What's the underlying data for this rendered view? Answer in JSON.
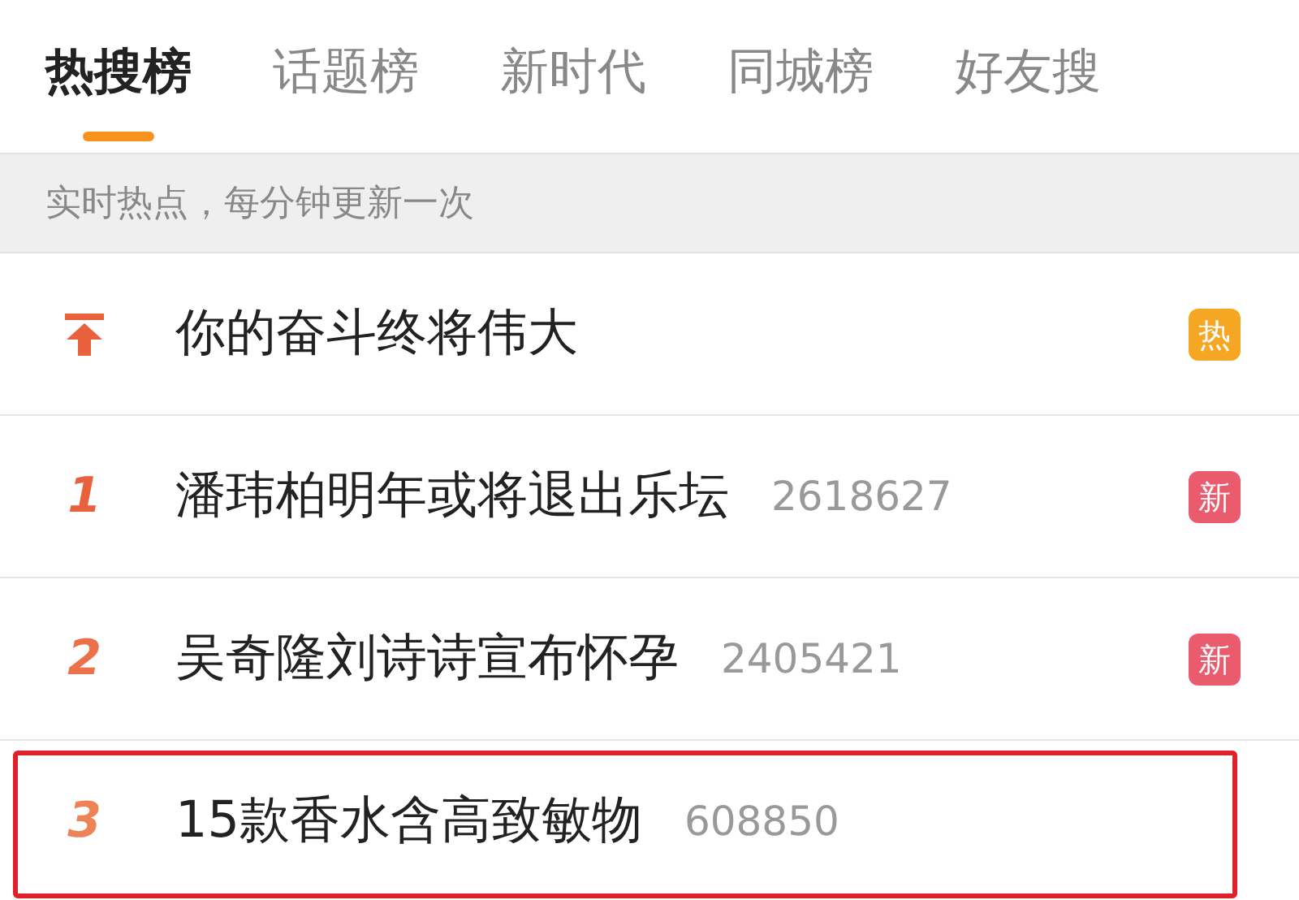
{
  "tabs": [
    {
      "label": "热搜榜",
      "selected": true
    },
    {
      "label": "话题榜",
      "selected": false
    },
    {
      "label": "新时代",
      "selected": false
    },
    {
      "label": "同城榜",
      "selected": false
    },
    {
      "label": "好友搜",
      "selected": false
    }
  ],
  "subtitle": "实时热点，每分钟更新一次",
  "items": [
    {
      "kind": "pinned",
      "title": "你的奋斗终将伟大",
      "badge": {
        "text": "热",
        "color": "#f5a623"
      },
      "highlighted": false
    },
    {
      "kind": "ranked",
      "rank": "1",
      "color": "#e8603c",
      "title": "潘玮柏明年或将退出乐坛",
      "count": "2618627",
      "badge": {
        "text": "新",
        "color": "#ea5b6e"
      },
      "highlighted": false
    },
    {
      "kind": "ranked",
      "rank": "2",
      "color": "#ec7048",
      "title": "吴奇隆刘诗诗宣布怀孕",
      "count": "2405421",
      "badge": {
        "text": "新",
        "color": "#ea5b6e"
      },
      "highlighted": false
    },
    {
      "kind": "ranked",
      "rank": "3",
      "color": "#ee8456",
      "title": "15款香水含高致敏物",
      "count": "608850",
      "highlighted": true
    }
  ]
}
